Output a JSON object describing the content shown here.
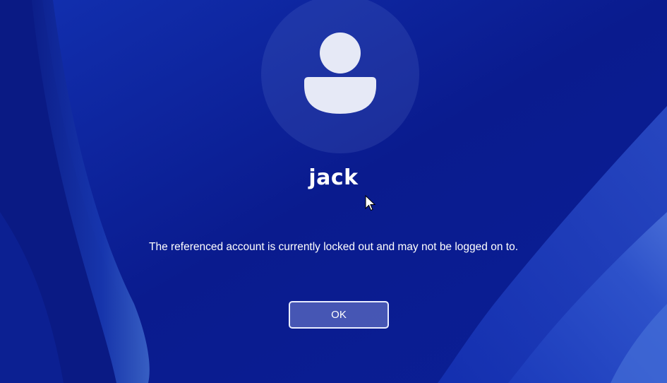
{
  "lock_screen": {
    "username": "jack",
    "message": "The referenced account is currently locked out and may not be logged on to.",
    "ok_label": "OK"
  },
  "icons": {
    "avatar": "user-silhouette-icon",
    "cursor": "mouse-pointer-icon"
  },
  "colors": {
    "background": "#0a1a8a",
    "accent_ribbon": "#2a48c4",
    "avatar_silhouette": "#e6e9f6",
    "button_border": "#e8ecff"
  }
}
